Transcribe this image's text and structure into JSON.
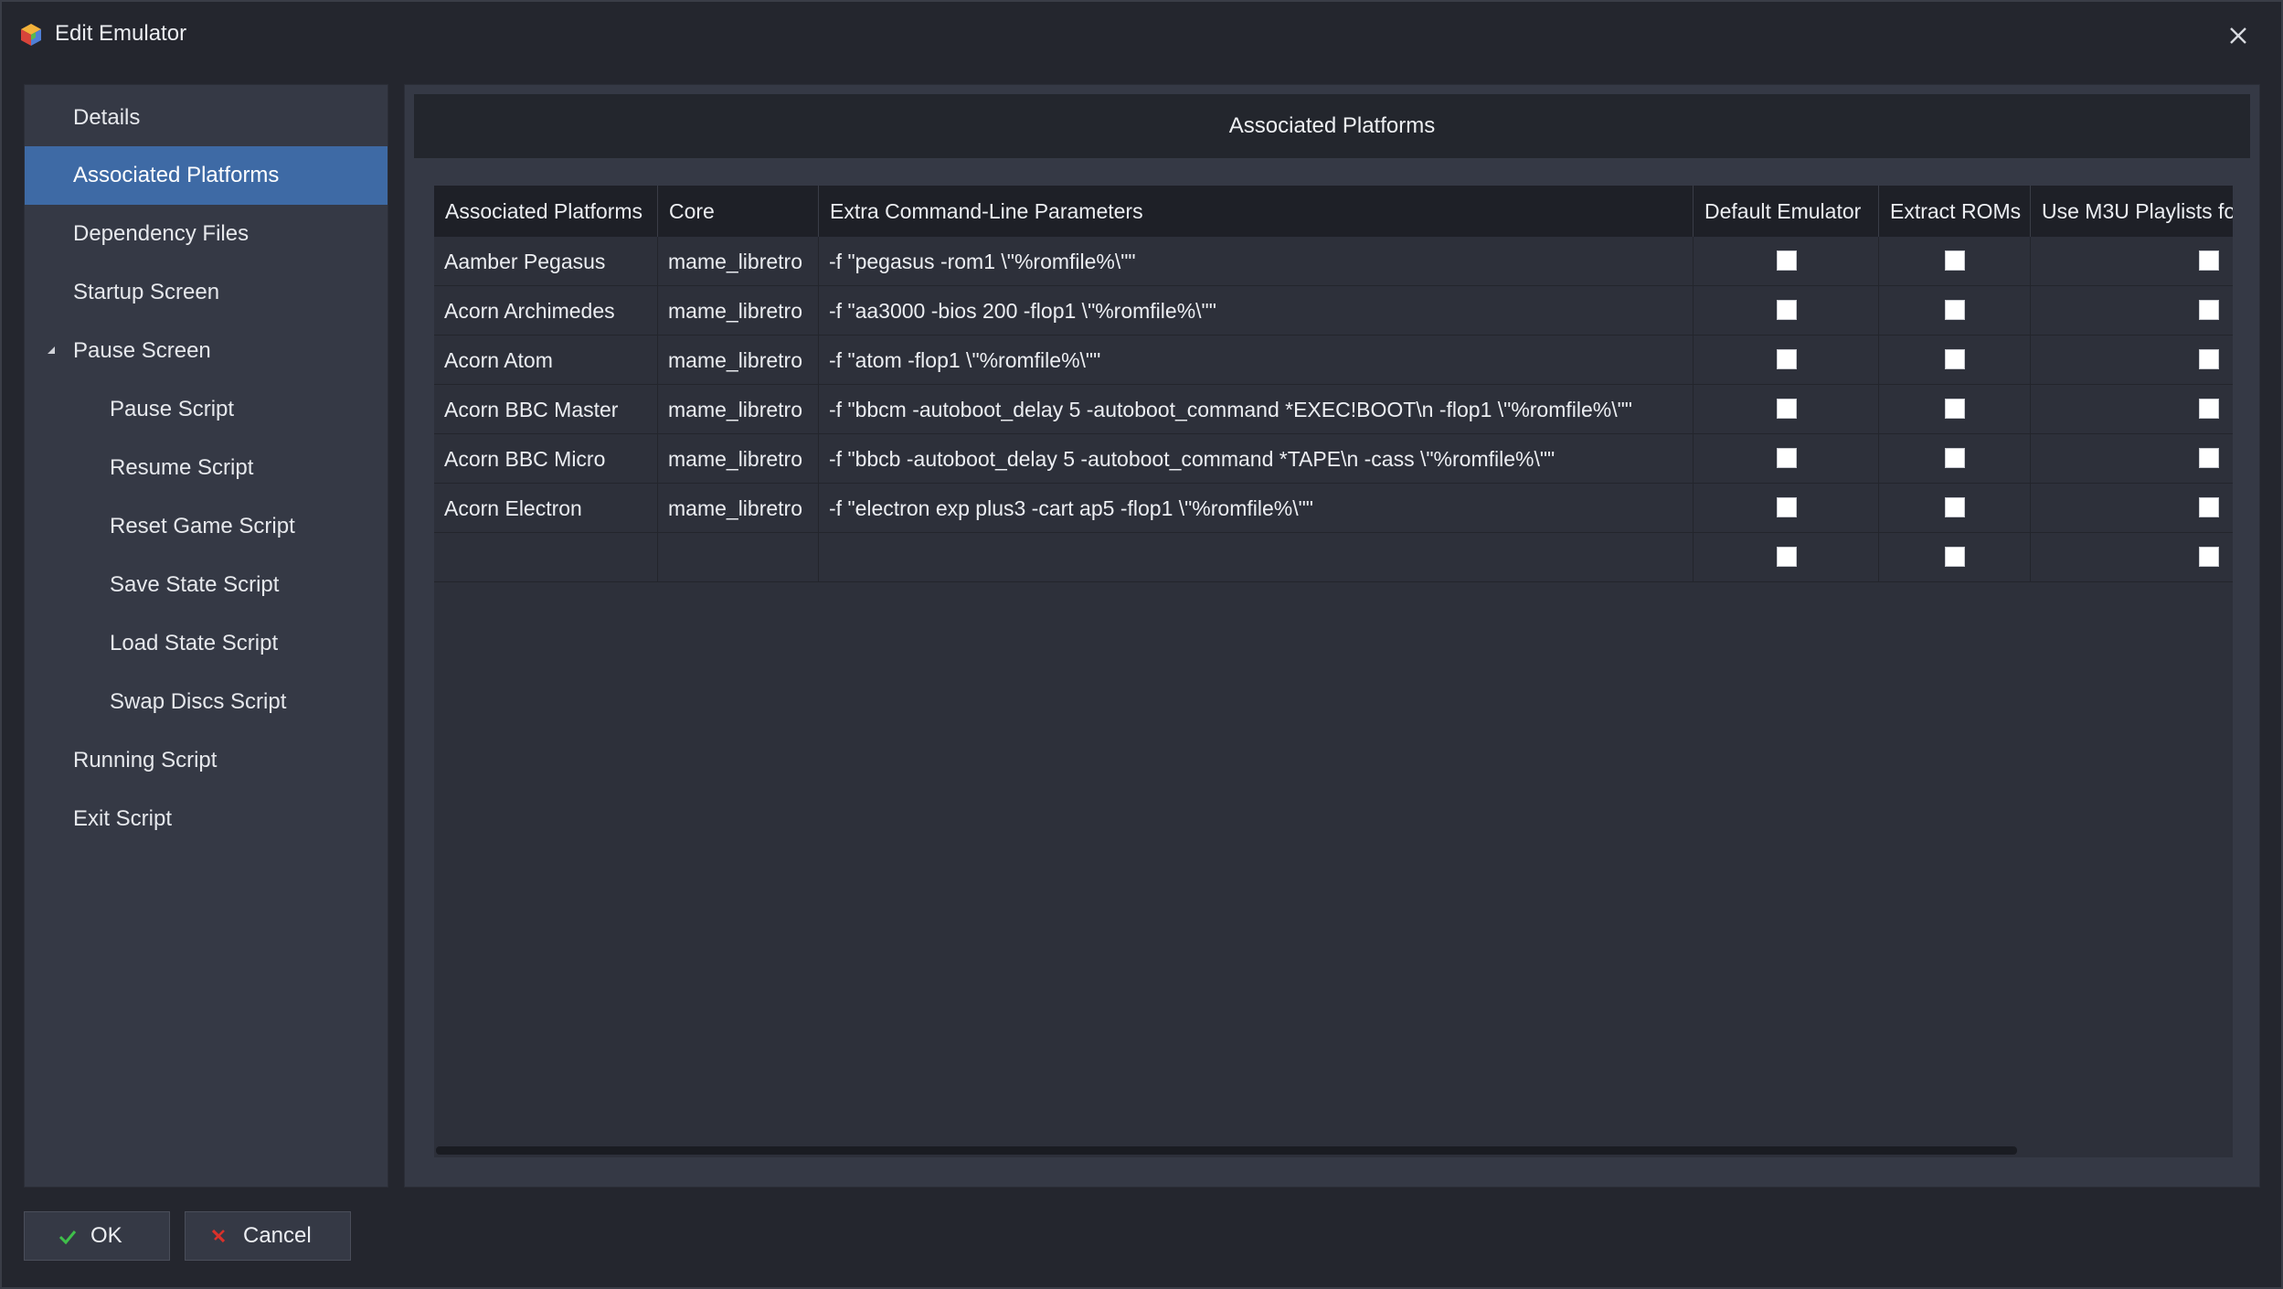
{
  "window": {
    "title": "Edit Emulator",
    "icon": "launchbox-cube-icon",
    "close_icon": "close-icon"
  },
  "sidebar": {
    "items": [
      {
        "label": "Details",
        "level": 0,
        "selected": false
      },
      {
        "label": "Associated Platforms",
        "level": 0,
        "selected": true
      },
      {
        "label": "Dependency Files",
        "level": 0,
        "selected": false
      },
      {
        "label": "Startup Screen",
        "level": 0,
        "selected": false
      },
      {
        "label": "Pause Screen",
        "level": 0,
        "selected": false,
        "expanded": true
      },
      {
        "label": "Pause Script",
        "level": 1,
        "selected": false
      },
      {
        "label": "Resume Script",
        "level": 1,
        "selected": false
      },
      {
        "label": "Reset Game Script",
        "level": 1,
        "selected": false
      },
      {
        "label": "Save State Script",
        "level": 1,
        "selected": false
      },
      {
        "label": "Load State Script",
        "level": 1,
        "selected": false
      },
      {
        "label": "Swap Discs Script",
        "level": 1,
        "selected": false
      },
      {
        "label": "Running Script",
        "level": 0,
        "selected": false
      },
      {
        "label": "Exit Script",
        "level": 0,
        "selected": false
      }
    ]
  },
  "main": {
    "header": "Associated Platforms",
    "table": {
      "columns": [
        "Associated Platforms",
        "Core",
        "Extra Command-Line Parameters",
        "Default Emulator",
        "Extract ROMs",
        "Use M3U Playlists fo"
      ],
      "rows": [
        {
          "platform": "Aamber Pegasus",
          "core": "mame_libretro",
          "params": "-f \"pegasus -rom1 \\\"%romfile%\\\"\"",
          "default": false,
          "extract": false,
          "m3u": false
        },
        {
          "platform": "Acorn Archimedes",
          "core": "mame_libretro",
          "params": "-f \"aa3000 -bios 200 -flop1 \\\"%romfile%\\\"\"",
          "default": false,
          "extract": false,
          "m3u": false
        },
        {
          "platform": "Acorn Atom",
          "core": "mame_libretro",
          "params": "-f \"atom -flop1 \\\"%romfile%\\\"\"",
          "default": false,
          "extract": false,
          "m3u": false
        },
        {
          "platform": "Acorn BBC Master",
          "core": "mame_libretro",
          "params": "-f \"bbcm -autoboot_delay 5 -autoboot_command *EXEC!BOOT\\n -flop1 \\\"%romfile%\\\"\"",
          "default": false,
          "extract": false,
          "m3u": false
        },
        {
          "platform": "Acorn BBC Micro",
          "core": "mame_libretro",
          "params": "-f \"bbcb -autoboot_delay 5 -autoboot_command *TAPE\\n -cass \\\"%romfile%\\\"\"",
          "default": false,
          "extract": false,
          "m3u": false
        },
        {
          "platform": "Acorn Electron",
          "core": "mame_libretro",
          "params": "-f \"electron exp plus3 -cart ap5 -flop1 \\\"%romfile%\\\"\"",
          "default": false,
          "extract": false,
          "m3u": false
        },
        {
          "platform": "",
          "core": "",
          "params": "",
          "default": false,
          "extract": false,
          "m3u": false
        }
      ]
    }
  },
  "buttons": {
    "ok": {
      "label": "OK",
      "icon": "checkmark-icon",
      "color": "#3fbf4a"
    },
    "cancel": {
      "label": "Cancel",
      "icon": "red-x-icon",
      "color": "#d9312a"
    }
  },
  "colors": {
    "selected": "#3e6aa5",
    "background": "#24262e",
    "panel": "#353945"
  }
}
